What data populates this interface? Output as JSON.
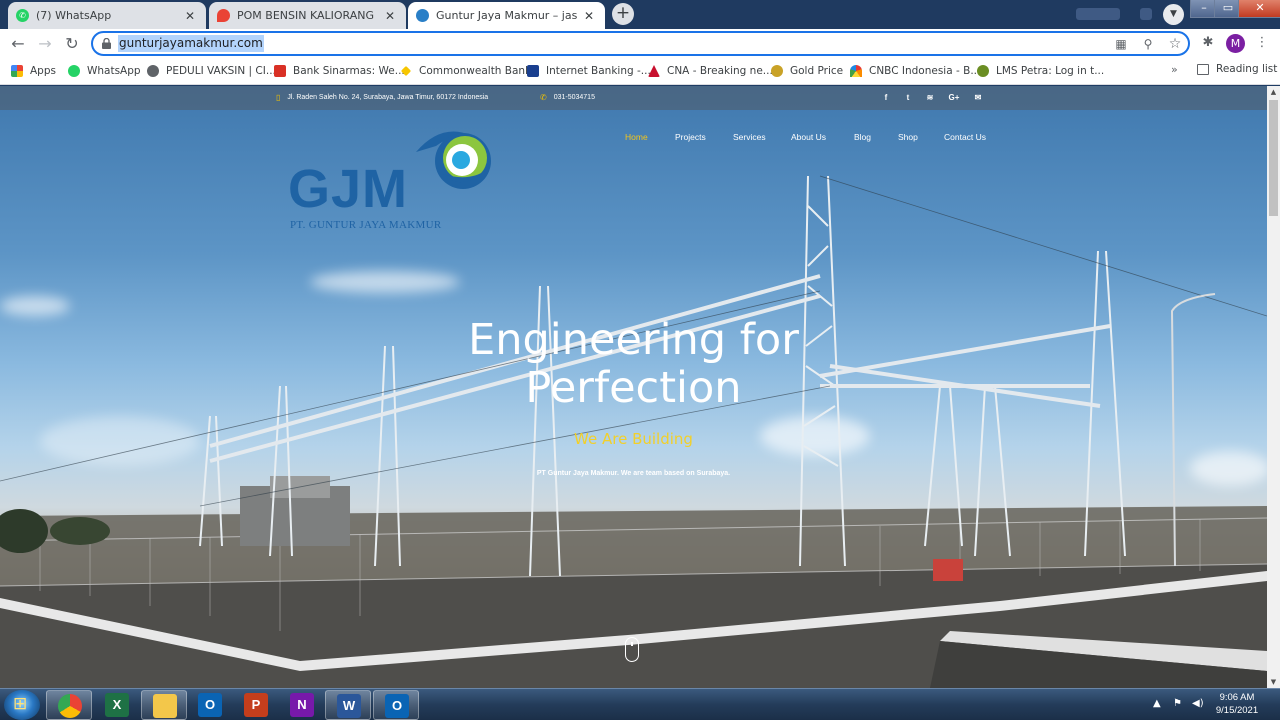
{
  "browser": {
    "tabs": [
      {
        "title": "(7) WhatsApp",
        "favicon": "whatsapp-icon"
      },
      {
        "title": "POM BENSIN KALIORANG - Goo",
        "favicon": "google-maps-icon"
      },
      {
        "title": "Guntur Jaya Makmur – jasa kontr",
        "favicon": "site-icon"
      }
    ],
    "url": "gunturjayamakmur.com",
    "profile_initial": "M",
    "bookmarks": [
      {
        "label": "Apps",
        "color": "#ea4335"
      },
      {
        "label": "WhatsApp",
        "color": "#25d366"
      },
      {
        "label": "PEDULI VAKSIN | CI...",
        "color": "#5f6368"
      },
      {
        "label": "Bank Sinarmas: We...",
        "color": "#d93025"
      },
      {
        "label": "Commonwealth Bank",
        "color": "#f7c600"
      },
      {
        "label": "Internet Banking -...",
        "color": "#1a3f8f"
      },
      {
        "label": "CNA - Breaking ne...",
        "color": "#c8102e"
      },
      {
        "label": "Gold Price",
        "color": "#c9a227"
      },
      {
        "label": "CNBC Indonesia - B...",
        "color": "#7a3fbf"
      },
      {
        "label": "LMS Petra: Log in t...",
        "color": "#6b8e23"
      }
    ],
    "reading_list": "Reading list"
  },
  "site": {
    "address": "Jl. Raden Saleh No. 24, Surabaya, Jawa Timur, 60172 Indonesia",
    "phone": "031-5034715",
    "nav": [
      "Home",
      "Projects",
      "Services",
      "About Us",
      "Blog",
      "Shop",
      "Contact Us"
    ],
    "logo_text": "GJM",
    "logo_sub": "PT. GUNTUR JAYA MAKMUR",
    "hero_title_line1": "Engineering for",
    "hero_title_line2": "Perfection",
    "hero_sub": "We Are Building",
    "hero_small": "PT Guntur Jaya Makmur. We are team based on Surabaya.",
    "colors": {
      "accent": "#f5c518",
      "brand": "#1f63a4"
    }
  },
  "taskbar": {
    "apps": [
      "chrome",
      "excel",
      "file-explorer",
      "outlook",
      "powerpoint",
      "onenote",
      "word",
      "outlook-2"
    ],
    "time": "9:06 AM",
    "date": "9/15/2021"
  }
}
